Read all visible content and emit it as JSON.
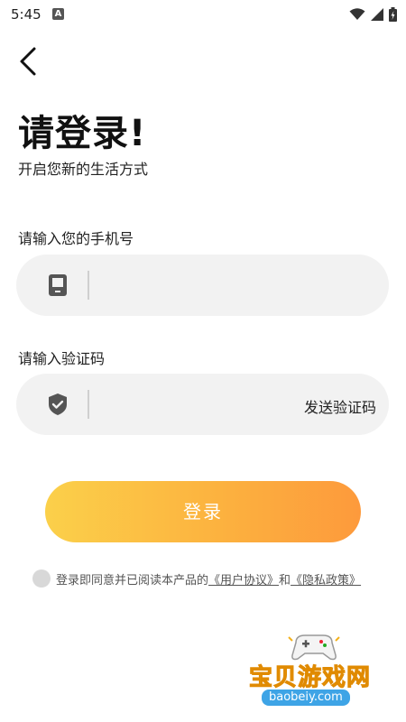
{
  "status_bar": {
    "time": "5:45",
    "a_badge": "A"
  },
  "header": {
    "title": "请登录!",
    "subtitle": "开启您新的生活方式"
  },
  "phone": {
    "label": "请输入您的手机号",
    "value": "",
    "placeholder": ""
  },
  "code": {
    "label": "请输入验证码",
    "value": "",
    "placeholder": "",
    "send_label": "发送验证码"
  },
  "login": {
    "label": "登录"
  },
  "agreement": {
    "prefix": "登录即同意并已阅读本产品的",
    "user_agreement": "《用户协议》",
    "joiner": "和",
    "privacy_policy": "《隐私政策》"
  },
  "watermark": {
    "text": "宝贝游戏网",
    "url": "baobeiy.com"
  },
  "icons": {
    "back": "chevron-left-icon",
    "phone": "phone-icon",
    "shield": "shield-check-icon",
    "wifi": "wifi-icon",
    "signal": "signal-icon",
    "battery": "battery-icon"
  },
  "colors": {
    "gradient_start": "#fbd04a",
    "gradient_end": "#fd9a3c",
    "input_bg": "#f2f2f2",
    "icon": "#555555"
  }
}
